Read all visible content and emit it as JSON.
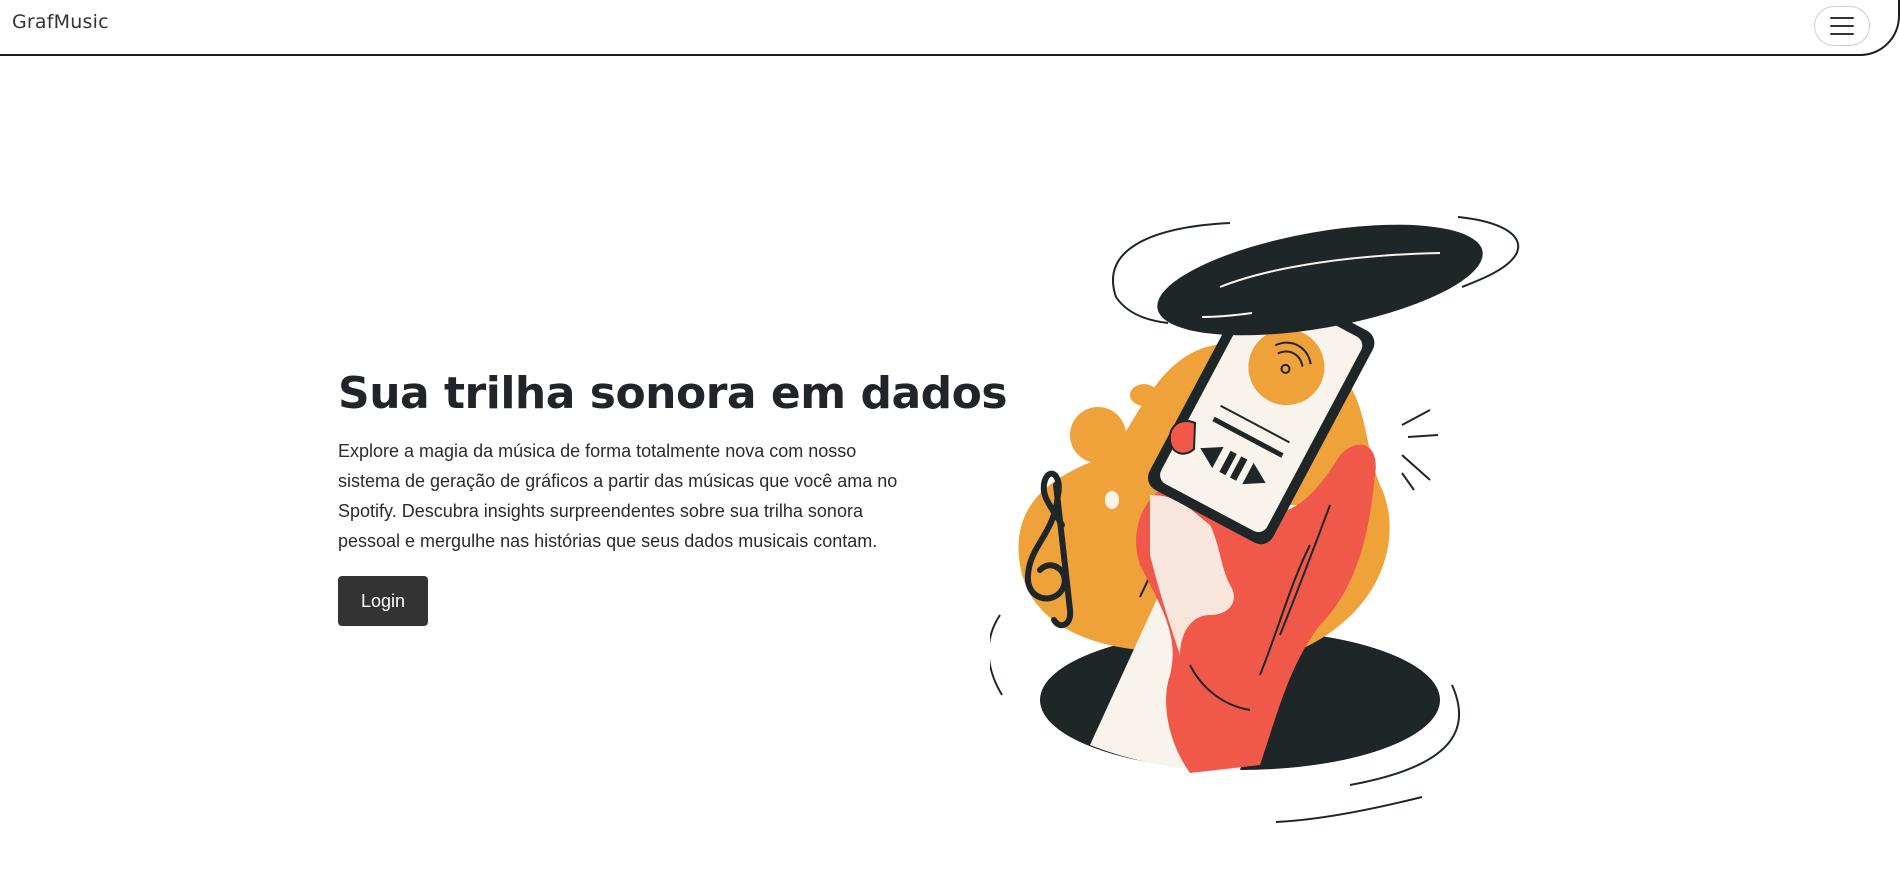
{
  "navbar": {
    "brand": "GrafMusic",
    "toggler_icon": "hamburger-menu-icon"
  },
  "hero": {
    "title": "Sua trilha sonora em dados",
    "description": "Explore a magia da música de forma totalmente nova com nosso sistema de geração de gráficos a partir das músicas que você ama no Spotify. Descubra insights surpreendentes sobre sua trilha sonora pessoal e mergulhe nas histórias que seus dados musicais contam.",
    "login_label": "Login"
  },
  "illustration": {
    "subject": "hand-holding-phone-music-illustration",
    "colors": {
      "dark": "#1e2628",
      "orange": "#f0a23a",
      "red": "#f0594a",
      "cream": "#f8f4ec"
    }
  }
}
